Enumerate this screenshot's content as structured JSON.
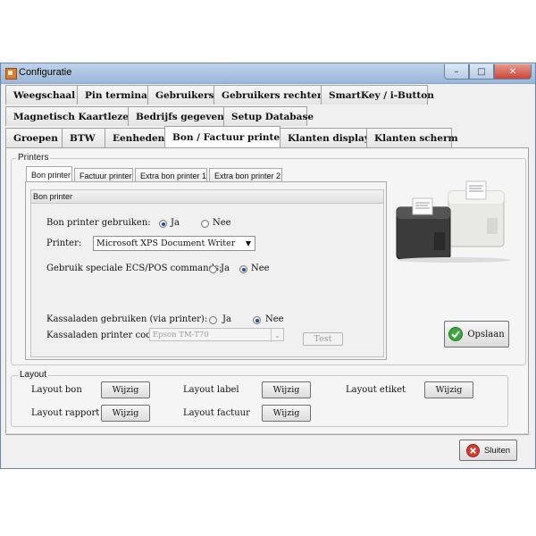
{
  "window": {
    "title": "Configuratie"
  },
  "tabs": {
    "row1": [
      "Weegschaal",
      "Pin terminal",
      "Gebruikers",
      "Gebruikers rechten",
      "SmartKey / i-Button"
    ],
    "row2": [
      "Magnetisch Kaartlezer",
      "Bedrijfs gegevens",
      "Setup Database"
    ],
    "row3": [
      "Groepen",
      "BTW",
      "Eenheden",
      "Bon / Factuur printer",
      "Klanten display",
      "Klanten scherm"
    ],
    "active": "Bon / Factuur printer"
  },
  "printers": {
    "group_label": "Printers",
    "subtabs": [
      "Bon printer",
      "Factuur printer",
      "Extra bon printer 1",
      "Extra bon printer 2"
    ],
    "panel_header": "Bon printer",
    "use_label": "Bon printer gebruiken:",
    "use_yes": "Ja",
    "use_no": "Nee",
    "use_value": "Ja",
    "printer_label": "Printer:",
    "printer_value": "Microsoft XPS Document Writer",
    "escpos_label": "Gebruik speciale ECS/POS commands:",
    "escpos_yes": "Ja",
    "escpos_no": "Nee",
    "escpos_value": "Nee",
    "drawer_label": "Kassaladen gebruiken (via printer):",
    "drawer_yes": "Ja",
    "drawer_no": "Nee",
    "drawer_value": "Nee",
    "drawer_code_label": "Kassaladen printer code:",
    "drawer_code_value": "Epson TM-T70",
    "test_button": "Test",
    "save_button": "Opslaan"
  },
  "layout": {
    "group_label": "Layout",
    "items": [
      {
        "label": "Layout bon",
        "button": "Wijzig"
      },
      {
        "label": "Layout label",
        "button": "Wijzig"
      },
      {
        "label": "Layout etiket",
        "button": "Wijzig"
      },
      {
        "label": "Layout rapport",
        "button": "Wijzig"
      },
      {
        "label": "Layout factuur",
        "button": "Wijzig"
      }
    ]
  },
  "footer": {
    "close_button": "Sluiten"
  },
  "colors": {
    "titlebar": "#9bb7d8",
    "save_check": "#3aa83a",
    "close_x": "#d9392b"
  },
  "icons": [
    "app-icon",
    "minimize-icon",
    "maximize-icon",
    "close-icon",
    "check-icon",
    "cancel-icon",
    "dropdown-arrow-icon"
  ]
}
